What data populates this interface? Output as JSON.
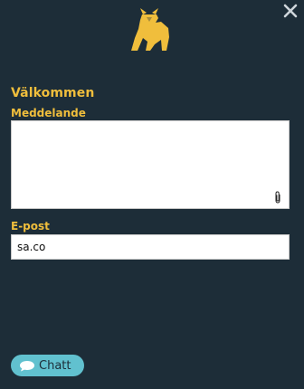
{
  "header": {
    "logo_icon": "bull-logo-icon",
    "close_icon": "close-icon"
  },
  "form": {
    "title": "Välkommen",
    "message_label": "Meddelande",
    "message_value": "",
    "attach_icon": "paperclip-icon",
    "email_label": "E-post",
    "email_value": "sa.co"
  },
  "footer": {
    "chat_label": "Chatt",
    "chat_icon": "speech-bubble-icon"
  },
  "colors": {
    "background": "#1d2d38",
    "accent": "#f0be3c",
    "chat_button": "#61c1cf",
    "field_bg": "#ffffff"
  }
}
